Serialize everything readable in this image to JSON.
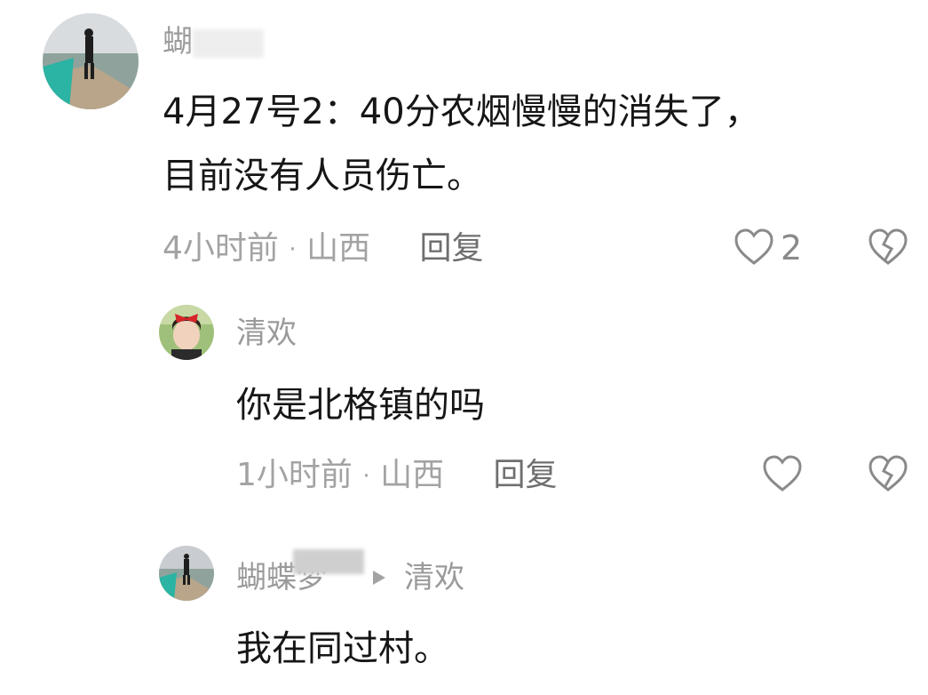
{
  "comments": [
    {
      "author": "蝴",
      "text_line1": "4月27号2：40分农烟慢慢的消失了，",
      "text_line2": "目前没有人员伤亡。",
      "time": "4小时前",
      "location": "山西",
      "reply_label": "回复",
      "like_count": "2"
    },
    {
      "author": "清欢",
      "text": "你是北格镇的吗",
      "time": "1小时前",
      "location": "山西",
      "reply_label": "回复"
    },
    {
      "author": "蝴蝶梦",
      "reply_to": "清欢",
      "text": "我在同过村。"
    }
  ],
  "separator": "·",
  "icons": [
    "avatar",
    "heart-icon",
    "dislike-heart-icon",
    "reply-arrow-icon"
  ],
  "colors": {
    "text": "#161616",
    "muted": "#a3a3a3",
    "reply": "#6f6f6f",
    "icon": "#8a8a8a"
  }
}
